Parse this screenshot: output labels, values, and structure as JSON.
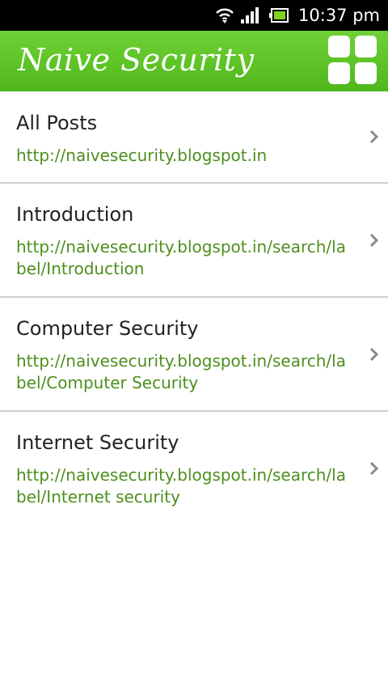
{
  "status_bar": {
    "time": "10:37 pm",
    "icons": [
      "wifi-icon",
      "signal-icon",
      "battery-icon"
    ]
  },
  "header": {
    "title": "Naive Security",
    "menu_icon": "grid-icon",
    "color": "#5ec326"
  },
  "items": [
    {
      "title": "All Posts",
      "url": "http://naivesecurity.blogspot.in"
    },
    {
      "title": "Introduction",
      "url": "http://naivesecurity.blogspot.in/search/label/Introduction"
    },
    {
      "title": "Computer Security",
      "url": "http://naivesecurity.blogspot.in/search/label/Computer Security"
    },
    {
      "title": "Internet Security",
      "url": "http://naivesecurity.blogspot.in/search/label/Internet security"
    }
  ],
  "colors": {
    "accent": "#5ec326",
    "link": "#4c8f1e",
    "title_text": "#222222",
    "divider": "#cfcfcf"
  }
}
